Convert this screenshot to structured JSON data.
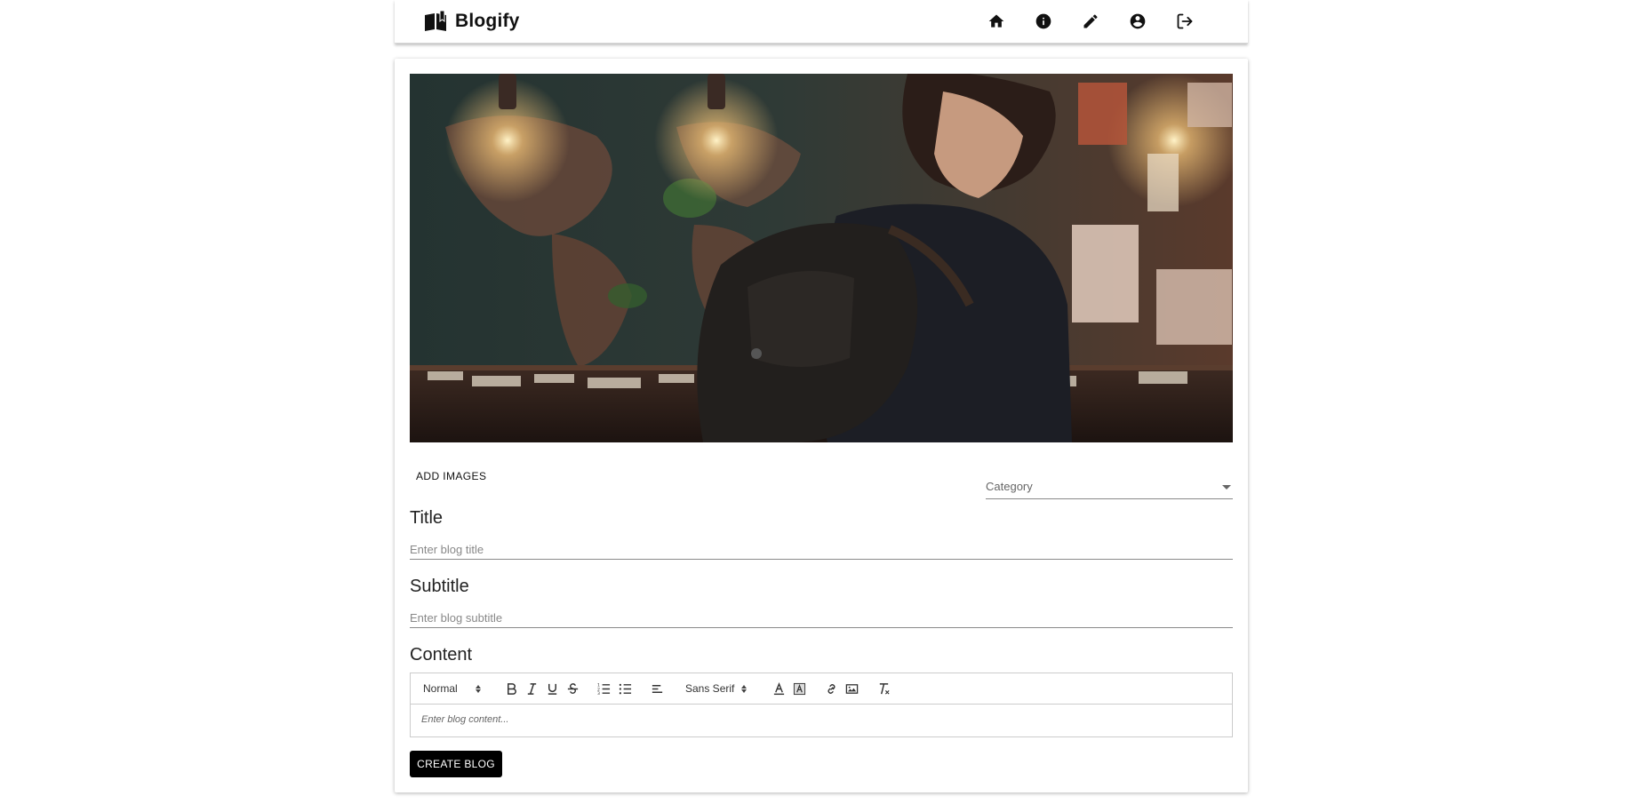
{
  "app": {
    "name": "Blogify",
    "logo_icon": "open-book-icon"
  },
  "nav": {
    "icons": [
      "home-icon",
      "info-icon",
      "pencil-icon",
      "account-icon",
      "logout-icon"
    ]
  },
  "hero": {
    "alt": "Anime boy with backpack in front of world map"
  },
  "form": {
    "add_images_label": "ADD IMAGES",
    "category_label": "Category",
    "title_heading": "Title",
    "title_placeholder": "Enter blog title",
    "subtitle_heading": "Subtitle",
    "subtitle_placeholder": "Enter blog subtitle",
    "content_heading": "Content",
    "content_placeholder": "Enter blog content...",
    "submit_label": "CREATE BLOG"
  },
  "editor_toolbar": {
    "header_select": "Normal",
    "font_select": "Sans Serif"
  },
  "colors": {
    "primary_button": "#000000",
    "text": "#222222"
  }
}
